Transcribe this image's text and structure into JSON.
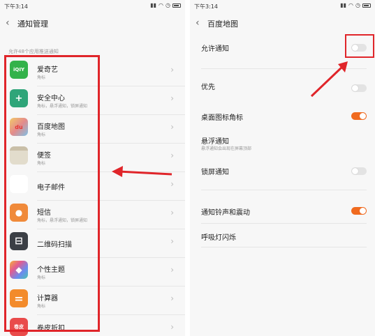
{
  "colors": {
    "accent": "#f06a1f",
    "annotation": "#e0252a"
  },
  "left": {
    "status": {
      "time": "下午3:14"
    },
    "header": {
      "back_icon": "chevron-left-icon",
      "title": "通知管理"
    },
    "section_note": "允许48个应用推送通知",
    "apps": [
      {
        "name": "爱奇艺",
        "sub": "角标",
        "icon": "iqiyi-icon",
        "icon_text": "iQIY",
        "color": "#33b24a"
      },
      {
        "name": "安全中心",
        "sub": "角标，悬浮通知，锁屏通知",
        "icon": "shield-icon",
        "icon_text": "+",
        "color": "#2fa579"
      },
      {
        "name": "百度地图",
        "sub": "角标",
        "icon": "map-icon",
        "icon_text": "du",
        "color": "#e4b552"
      },
      {
        "name": "便签",
        "sub": "角标",
        "icon": "notes-icon",
        "icon_text": "",
        "color": "#e2dccc"
      },
      {
        "name": "电子邮件",
        "sub": "",
        "icon": "email-icon",
        "icon_text": "",
        "color": "#ffffff"
      },
      {
        "name": "短信",
        "sub": "角标，悬浮通知，锁屏通知",
        "icon": "message-icon",
        "icon_text": "●",
        "color": "#f08a3a"
      },
      {
        "name": "二维码扫描",
        "sub": "",
        "icon": "qr-scan-icon",
        "icon_text": "⊟",
        "color": "#3b3f45"
      },
      {
        "name": "个性主题",
        "sub": "角标",
        "icon": "theme-icon",
        "icon_text": "◆",
        "color": "#8a6fe0"
      },
      {
        "name": "计算器",
        "sub": "角标",
        "icon": "calculator-icon",
        "icon_text": "=",
        "color": "#f38b2b"
      },
      {
        "name": "卷皮折扣",
        "sub": "",
        "icon": "juanpi-icon",
        "icon_text": "卷皮",
        "color": "#e94b4b"
      }
    ]
  },
  "right": {
    "status": {
      "time": "下午3:14"
    },
    "header": {
      "back_icon": "chevron-left-icon",
      "title": "百度地图"
    },
    "settings": [
      {
        "label": "允许通知",
        "sub": "",
        "on": false
      },
      {
        "label": "优先",
        "sub": "",
        "on": false
      },
      {
        "label": "桌面图标角标",
        "sub": "",
        "on": true
      },
      {
        "label": "悬浮通知",
        "sub": "悬浮通知会出现在屏幕顶部",
        "on": false
      },
      {
        "label": "锁屏通知",
        "sub": "",
        "on": false
      },
      {
        "label": "通知铃声和震动",
        "sub": "",
        "on": true
      },
      {
        "label": "呼吸灯闪烁",
        "sub": "",
        "on": null
      }
    ]
  }
}
